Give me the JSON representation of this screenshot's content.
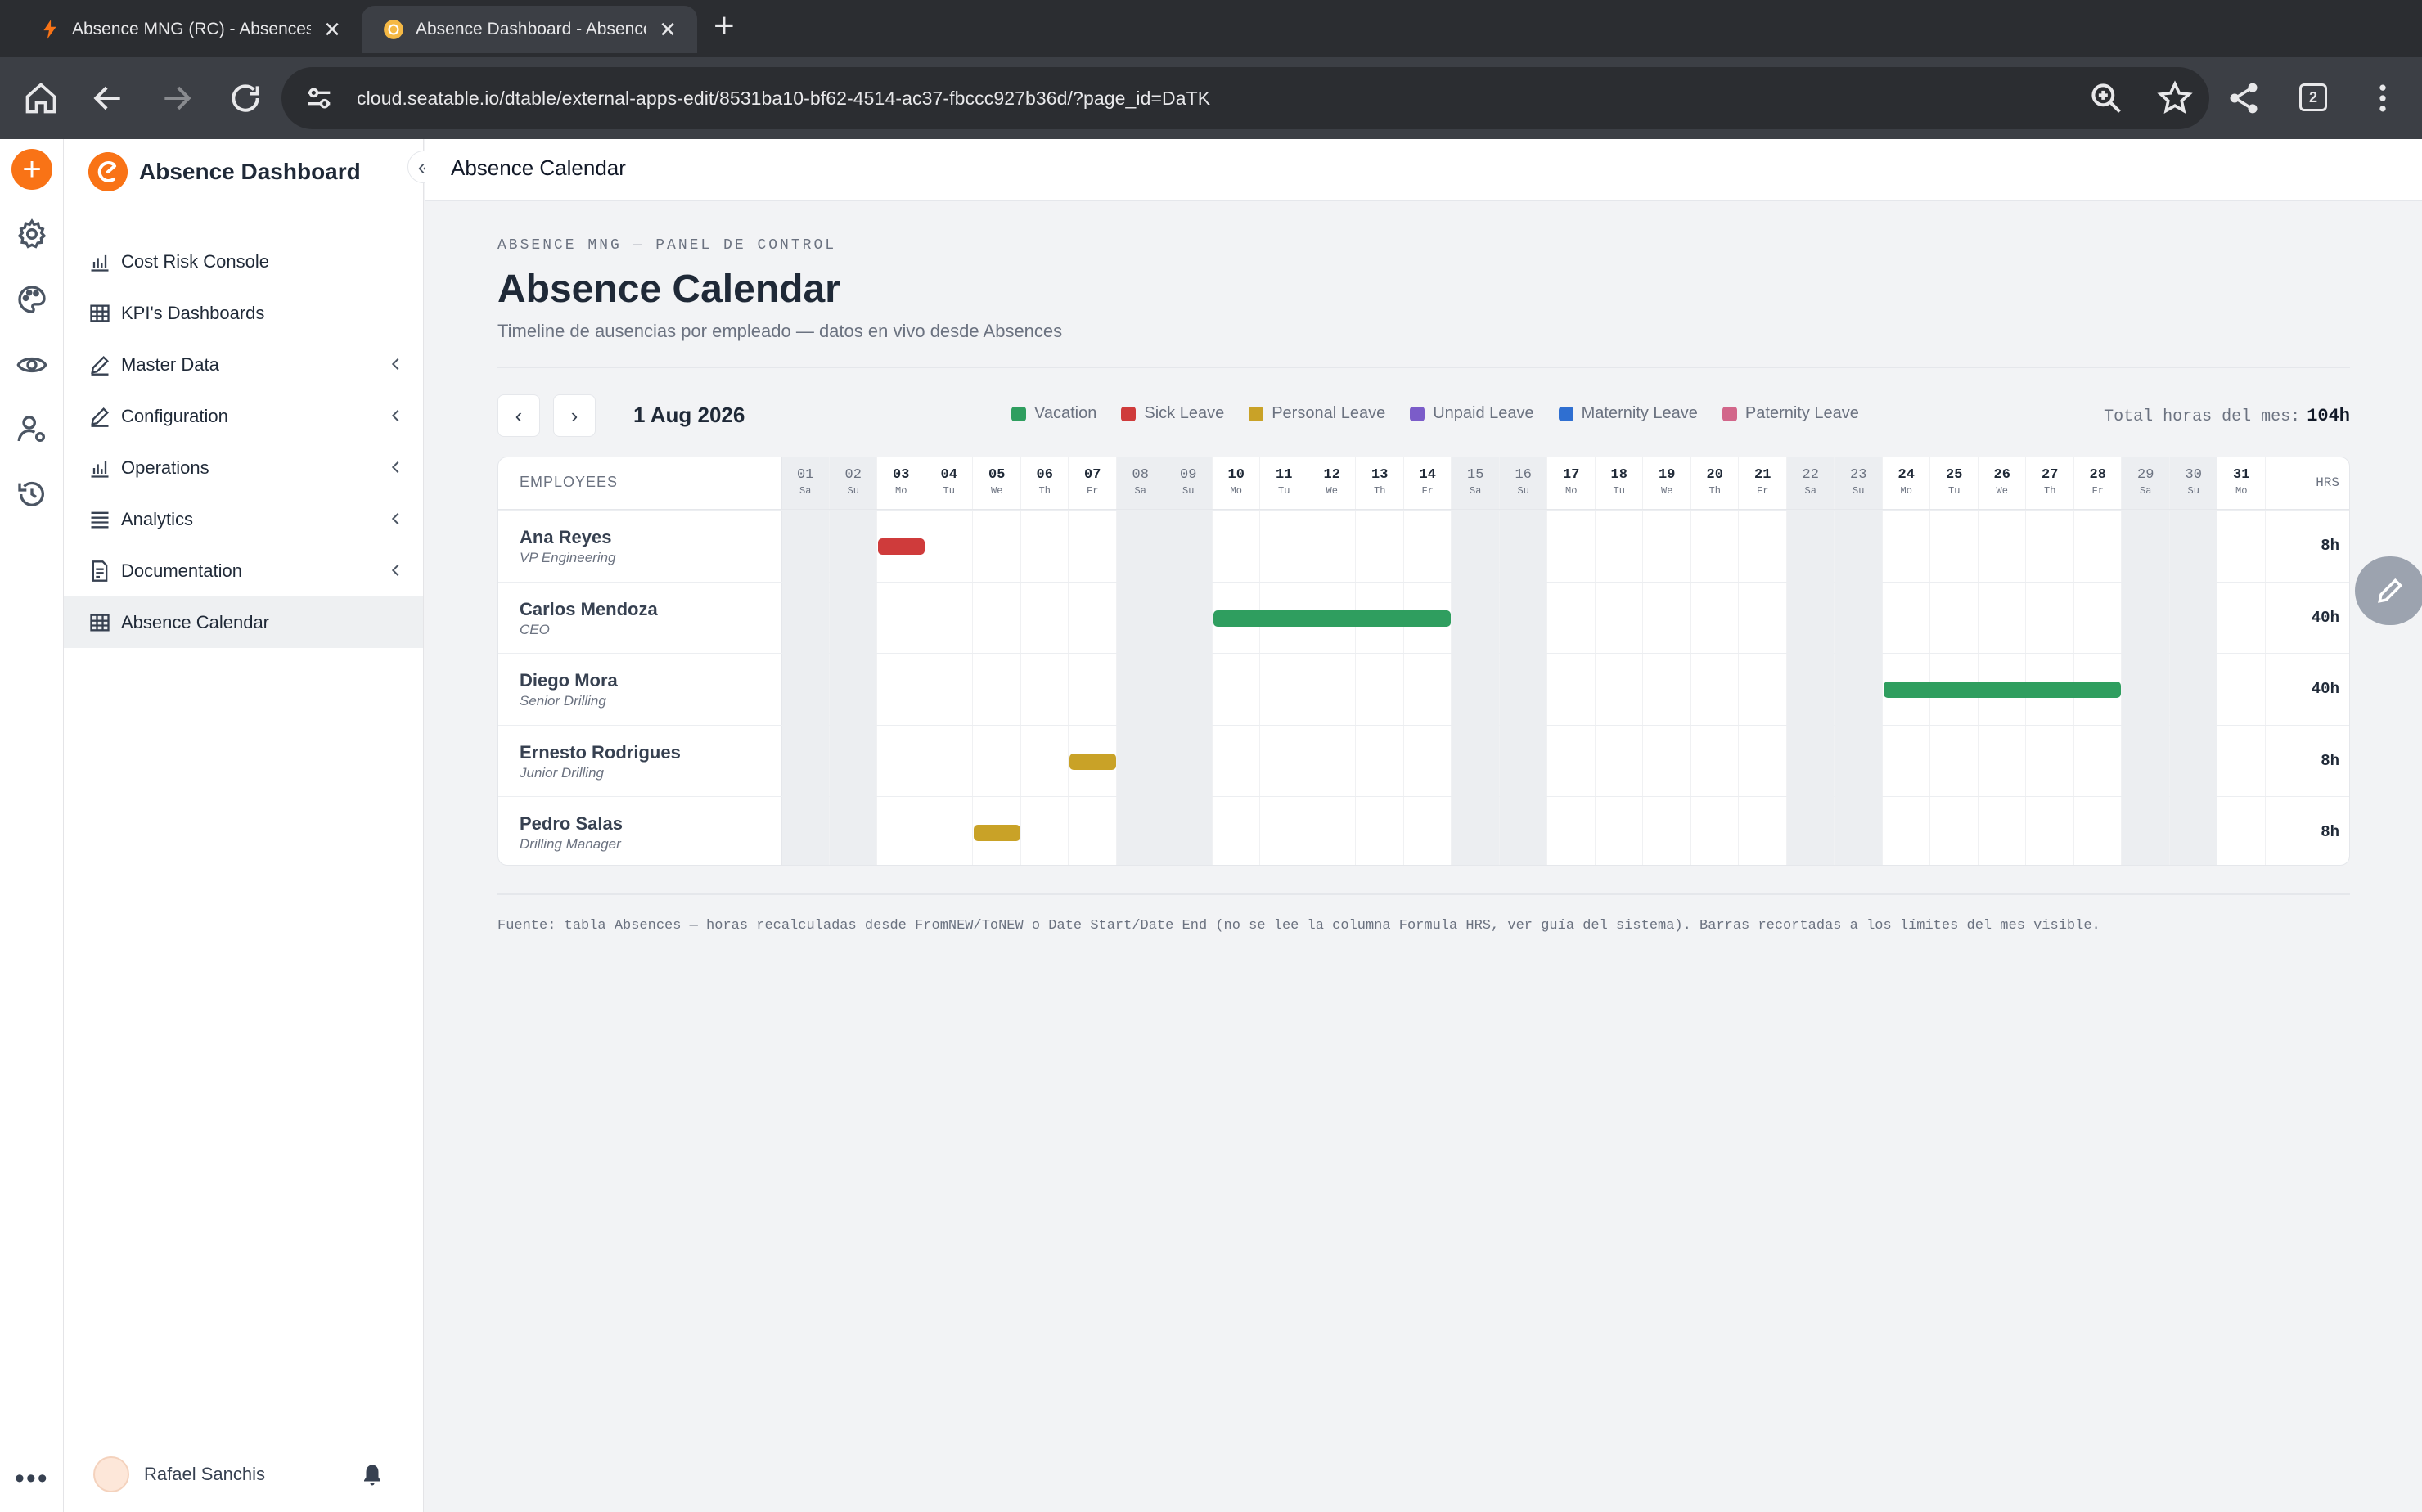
{
  "browser": {
    "tabs": [
      {
        "title": "Absence MNG (RC) - Absences",
        "active": false
      },
      {
        "title": "Absence Dashboard - Absence Cal",
        "active": true
      }
    ],
    "url": "cloud.seatable.io/dtable/external-apps-edit/8531ba10-bf62-4514-ac37-fbccc927b36d/?page_id=DaTK",
    "tab_count": "2"
  },
  "sidebar": {
    "title": "Absence Dashboard",
    "items": [
      {
        "label": "Cost Risk Console",
        "icon": "chart-icon",
        "has_submenu": false
      },
      {
        "label": "KPI's Dashboards",
        "icon": "table-icon",
        "has_submenu": false
      },
      {
        "label": "Master Data",
        "icon": "pen-icon",
        "has_submenu": true
      },
      {
        "label": "Configuration",
        "icon": "pen-icon",
        "has_submenu": true
      },
      {
        "label": "Operations",
        "icon": "chart-icon",
        "has_submenu": true
      },
      {
        "label": "Analytics",
        "icon": "list-icon",
        "has_submenu": true
      },
      {
        "label": "Documentation",
        "icon": "document-icon",
        "has_submenu": true
      },
      {
        "label": "Absence Calendar",
        "icon": "table-icon",
        "has_submenu": false,
        "active": true
      }
    ],
    "user": "Rafael Sanchis"
  },
  "page": {
    "header_title": "Absence Calendar",
    "eyebrow": "ABSENCE MNG — PANEL DE CONTROL",
    "title": "Absence Calendar",
    "subtitle": "Timeline de ausencias por empleado — datos en vivo desde Absences",
    "month": "1 Aug 2026",
    "prev": "‹",
    "next": "›",
    "total_label": "Total horas del mes:",
    "total_value": "104h",
    "footnote": "Fuente: tabla Absences — horas recalculadas desde FromNEW/ToNEW o Date Start/Date End (no se lee la columna Formula HRS, ver guía del sistema). Barras recortadas a los límites del mes visible."
  },
  "legend": [
    {
      "label": "Vacation",
      "color": "#2f9e5f"
    },
    {
      "label": "Sick Leave",
      "color": "#cf3b3b"
    },
    {
      "label": "Personal Leave",
      "color": "#c9a227"
    },
    {
      "label": "Unpaid Leave",
      "color": "#7b5cc9"
    },
    {
      "label": "Maternity Leave",
      "color": "#2f6fd1"
    },
    {
      "label": "Paternity Leave",
      "color": "#d2668a"
    }
  ],
  "calendar": {
    "employees_header": "EMPLOYEES",
    "hrs_header": "HRS",
    "days": [
      {
        "num": "01",
        "wd": "Sa",
        "weekend": true
      },
      {
        "num": "02",
        "wd": "Su",
        "weekend": true
      },
      {
        "num": "03",
        "wd": "Mo",
        "weekend": false
      },
      {
        "num": "04",
        "wd": "Tu",
        "weekend": false
      },
      {
        "num": "05",
        "wd": "We",
        "weekend": false
      },
      {
        "num": "06",
        "wd": "Th",
        "weekend": false
      },
      {
        "num": "07",
        "wd": "Fr",
        "weekend": false
      },
      {
        "num": "08",
        "wd": "Sa",
        "weekend": true
      },
      {
        "num": "09",
        "wd": "Su",
        "weekend": true
      },
      {
        "num": "10",
        "wd": "Mo",
        "weekend": false
      },
      {
        "num": "11",
        "wd": "Tu",
        "weekend": false
      },
      {
        "num": "12",
        "wd": "We",
        "weekend": false
      },
      {
        "num": "13",
        "wd": "Th",
        "weekend": false
      },
      {
        "num": "14",
        "wd": "Fr",
        "weekend": false
      },
      {
        "num": "15",
        "wd": "Sa",
        "weekend": true
      },
      {
        "num": "16",
        "wd": "Su",
        "weekend": true
      },
      {
        "num": "17",
        "wd": "Mo",
        "weekend": false
      },
      {
        "num": "18",
        "wd": "Tu",
        "weekend": false
      },
      {
        "num": "19",
        "wd": "We",
        "weekend": false
      },
      {
        "num": "20",
        "wd": "Th",
        "weekend": false
      },
      {
        "num": "21",
        "wd": "Fr",
        "weekend": false
      },
      {
        "num": "22",
        "wd": "Sa",
        "weekend": true
      },
      {
        "num": "23",
        "wd": "Su",
        "weekend": true
      },
      {
        "num": "24",
        "wd": "Mo",
        "weekend": false
      },
      {
        "num": "25",
        "wd": "Tu",
        "weekend": false
      },
      {
        "num": "26",
        "wd": "We",
        "weekend": false
      },
      {
        "num": "27",
        "wd": "Th",
        "weekend": false
      },
      {
        "num": "28",
        "wd": "Fr",
        "weekend": false
      },
      {
        "num": "29",
        "wd": "Sa",
        "weekend": true
      },
      {
        "num": "30",
        "wd": "Su",
        "weekend": true
      },
      {
        "num": "31",
        "wd": "Mo",
        "weekend": false
      }
    ],
    "rows": [
      {
        "name": "Ana Reyes",
        "role": "VP Engineering",
        "hours": "8h",
        "absence": {
          "type": "Sick Leave",
          "from": 3,
          "to": 3
        }
      },
      {
        "name": "Carlos Mendoza",
        "role": "CEO",
        "hours": "40h",
        "absence": {
          "type": "Vacation",
          "from": 10,
          "to": 14
        }
      },
      {
        "name": "Diego Mora",
        "role": "Senior Drilling",
        "hours": "40h",
        "absence": {
          "type": "Vacation",
          "from": 24,
          "to": 28
        }
      },
      {
        "name": "Ernesto Rodrigues",
        "role": "Junior Drilling",
        "hours": "8h",
        "absence": {
          "type": "Personal Leave",
          "from": 7,
          "to": 7
        }
      },
      {
        "name": "Pedro Salas",
        "role": "Drilling Manager",
        "hours": "8h",
        "absence": {
          "type": "Personal Leave",
          "from": 5,
          "to": 5
        }
      }
    ]
  }
}
